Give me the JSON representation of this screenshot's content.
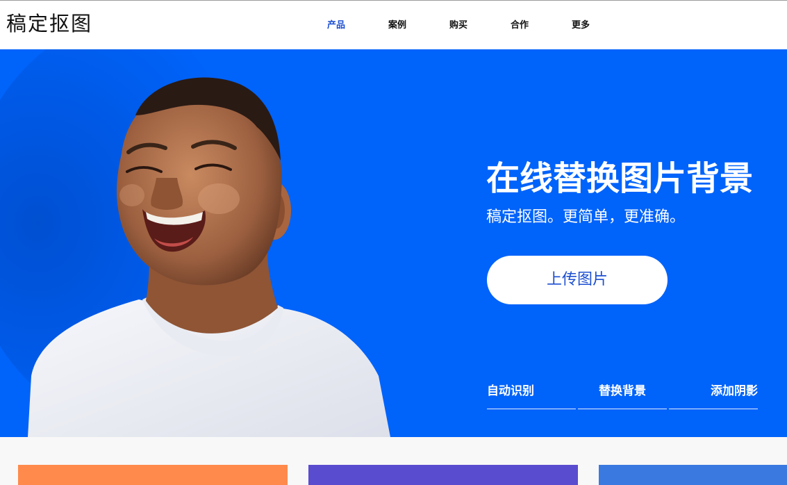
{
  "header": {
    "logo": "稿定抠图",
    "nav": [
      {
        "label": "产品",
        "active": true
      },
      {
        "label": "案例",
        "active": false
      },
      {
        "label": "购买",
        "active": false
      },
      {
        "label": "合作",
        "active": false
      },
      {
        "label": "更多",
        "active": false
      }
    ]
  },
  "hero": {
    "title": "在线替换图片背景",
    "subtitle": "稿定抠图。更简单，更准确。",
    "upload_label": "上传图片",
    "features": [
      "自动识别",
      "替换背景",
      "添加阴影"
    ],
    "background_color": "#0063fa",
    "image_subject": "laughing boy in white t-shirt"
  },
  "cards": {
    "colors": [
      "#ff8a4c",
      "#5a4ccf",
      "#3a7ae0"
    ]
  }
}
